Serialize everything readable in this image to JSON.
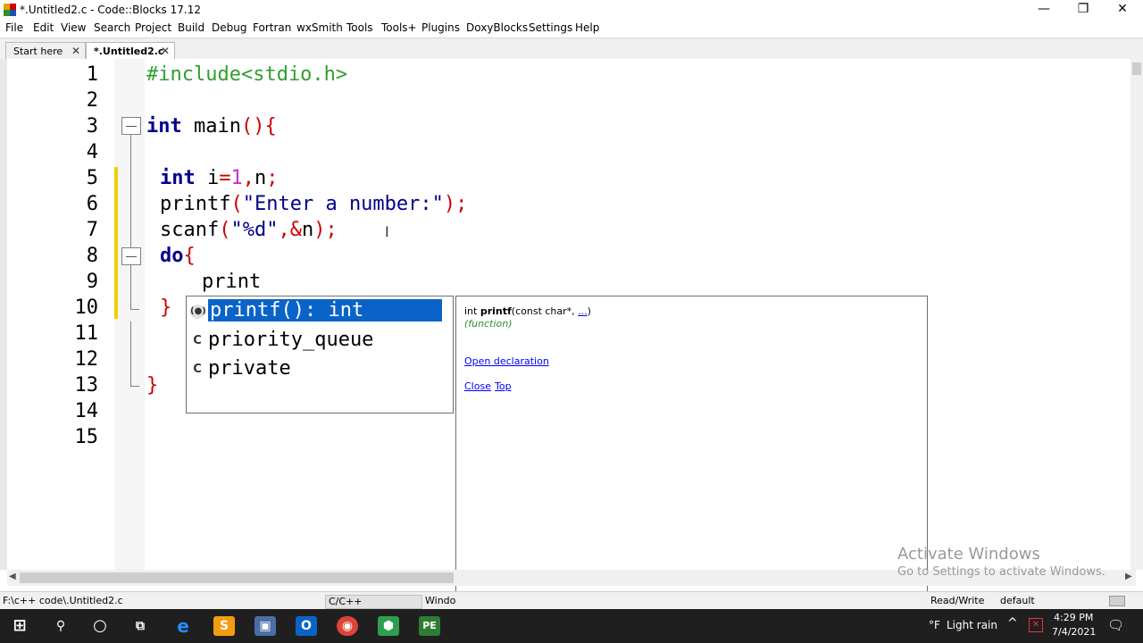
{
  "window": {
    "title": "*.Untitled2.c - Code::Blocks 17.12"
  },
  "menu": [
    "File",
    "Edit",
    "View",
    "Search",
    "Project",
    "Build",
    "Debug",
    "Fortran",
    "wxSmith",
    "Tools",
    "Tools+",
    "Plugins",
    "DoxyBlocks",
    "Settings",
    "Help"
  ],
  "tabs": [
    {
      "label": "Start here"
    },
    {
      "label": "*.Untitled2.c"
    }
  ],
  "editor": {
    "line_numbers": [
      "1",
      "2",
      "3",
      "4",
      "5",
      "6",
      "7",
      "8",
      "9",
      "10",
      "11",
      "12",
      "13",
      "14",
      "15"
    ],
    "lines": {
      "l1": "#include<stdio.h>",
      "l3_kw": "int",
      "l3_rest": " main",
      "l3_op": "(){",
      "l5_kw": "int",
      "l5_a": " i",
      "l5_eq": "=",
      "l5_num": "1",
      "l5_comma": ",",
      "l5_b": "n",
      "l5_semi": ";",
      "l6_fn": "printf",
      "l6_op1": "(",
      "l6_str": "\"Enter a number:\"",
      "l6_op2": ");",
      "l7_fn": "scanf",
      "l7_op1": "(",
      "l7_str": "\"%d\"",
      "l7_op2": ",&",
      "l7_b": "n",
      "l7_op3": ");",
      "l8_kw": "do",
      "l8_op": "{",
      "l9": "print",
      "l10": "}",
      "l13": "}"
    }
  },
  "autocomplete": {
    "items": [
      {
        "icon": "f",
        "label": "printf(): int",
        "selected": true
      },
      {
        "icon": "C",
        "label": "priority_queue",
        "selected": false
      },
      {
        "icon": "C",
        "label": "private",
        "selected": false
      }
    ],
    "doc": {
      "prefix": "int ",
      "name": "printf",
      "params": "(const char*, ",
      "ellipsis": "...",
      "close_paren": ")",
      "kind": "(function)",
      "open_declaration": "Open declaration",
      "close": "Close",
      "top": "Top"
    }
  },
  "statusbar": {
    "path": "F:\\c++ code\\.Untitled2.c",
    "language": "C/C++",
    "windows": "Windo",
    "mode": "Read/Write",
    "profile": "default"
  },
  "watermark": {
    "line1": "Activate Windows",
    "line2": "Go to Settings to activate Windows."
  },
  "taskbar": {
    "weather_temp": "°F",
    "weather": "Light rain",
    "time": "4:29 PM",
    "date": "7/4/2021"
  }
}
